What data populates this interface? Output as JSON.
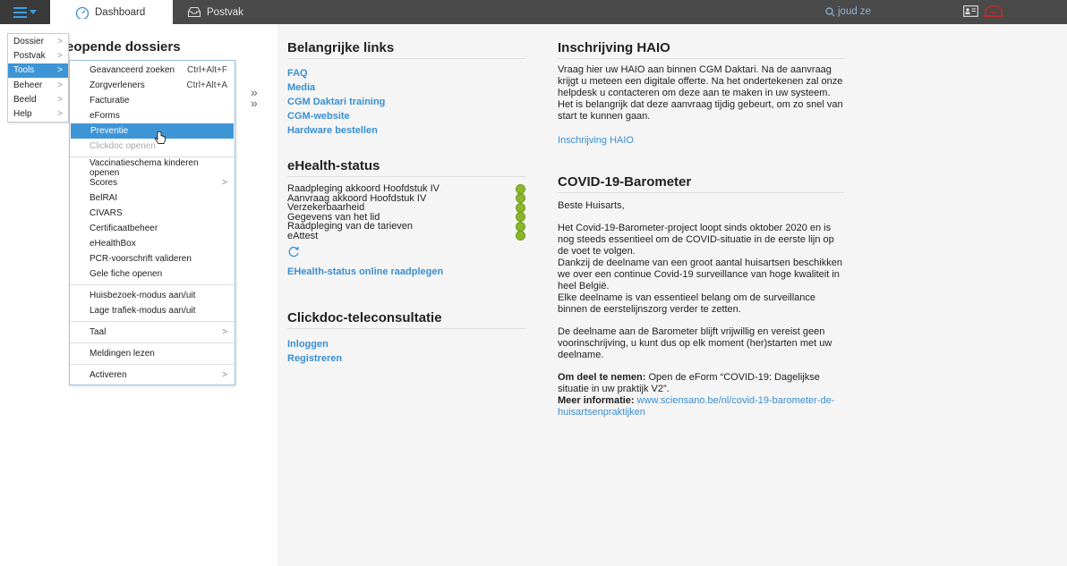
{
  "topbar": {
    "dashboard_label": "Dashboard",
    "postvak_label": "Postvak",
    "search_placeholder": "joud ze"
  },
  "left": {
    "title": "eopende dossiers"
  },
  "main_menu": [
    {
      "label": "Dossier"
    },
    {
      "label": "Postvak"
    },
    {
      "label": "Tools"
    },
    {
      "label": "Beheer"
    },
    {
      "label": "Beeld"
    },
    {
      "label": "Help"
    }
  ],
  "tools_menu": {
    "items": [
      {
        "label": "Geavanceerd zoeken",
        "shortcut": "Ctrl+Alt+F"
      },
      {
        "label": "Zorgverleners",
        "shortcut": "Ctrl+Alt+A"
      },
      {
        "label": "Facturatie"
      },
      {
        "label": "eForms"
      },
      {
        "label": "Preventie"
      },
      {
        "label": "Clickdoc openen"
      },
      {
        "label": "Vaccinatieschema kinderen openen"
      },
      {
        "label": "Scores"
      },
      {
        "label": "BelRAI"
      },
      {
        "label": "CIVARS"
      },
      {
        "label": "Certificaatbeheer"
      },
      {
        "label": "eHealthBox"
      },
      {
        "label": "PCR-voorschrift valideren"
      },
      {
        "label": "Gele fiche openen"
      },
      {
        "label": "Huisbezoek-modus aan/uit"
      },
      {
        "label": "Lage trafiek-modus aan/uit"
      },
      {
        "label": "Taal"
      },
      {
        "label": "Meldingen lezen"
      },
      {
        "label": "Activeren"
      }
    ]
  },
  "links": {
    "title": "Belangrijke links",
    "items": [
      "FAQ",
      "Media",
      "CGM Daktari training",
      "CGM-website",
      "Hardware bestellen"
    ]
  },
  "ehealth": {
    "title": "eHealth-status",
    "rows": [
      "Raadpleging akkoord Hoofdstuk IV",
      "Aanvraag akkoord Hoofdstuk IV",
      "Verzekerbaarheid",
      "Gegevens van het lid",
      "Raadpleging van de tarieven",
      "eAttest"
    ],
    "status_color": "#8ab82a",
    "online_link": "EHealth-status online raadplegen"
  },
  "clickdoc": {
    "title": "Clickdoc-teleconsultatie",
    "login": "Inloggen",
    "register": "Registreren"
  },
  "haio": {
    "title": "Inschrijving HAIO",
    "text": "Vraag hier uw HAIO aan binnen CGM Daktari. Na de aanvraag krijgt u meteen een digitale offerte. Na het ondertekenen zal onze helpdesk u contacteren om deze aan te maken in uw systeem. Het is belangrijk dat deze aanvraag tijdig gebeurt, om zo snel van start te kunnen gaan.",
    "link": "Inschrijving HAIO"
  },
  "covid": {
    "title": "COVID-19-Barometer",
    "greeting": "Beste Huisarts,",
    "p1": "Het Covid-19-Barometer-project loopt sinds oktober 2020 en is nog steeds essentieel om de COVID-situatie in de eerste lijn op de voet te volgen.",
    "p2": "Dankzij de deelname van een groot aantal huisartsen beschikken we over een continue Covid-19 surveillance van hoge kwaliteit in heel België.",
    "p3": "Elke deelname is van essentieel belang om de surveillance binnen de eerstelijnszorg verder te zetten.",
    "p4": "De deelname aan de Barometer blijft vrijwillig en vereist geen voorinschrijving, u kunt dus op elk moment (her)starten met uw deelname.",
    "how_label": "Om deel te nemen:",
    "how_text": " Open de eForm “COVID-19: Dagelijkse situatie in uw praktijk V2”.",
    "info_label": "Meer informatie:",
    "info_link": "www.sciensano.be/nl/covid-19-barometer-de-huisartsenpraktijken"
  }
}
